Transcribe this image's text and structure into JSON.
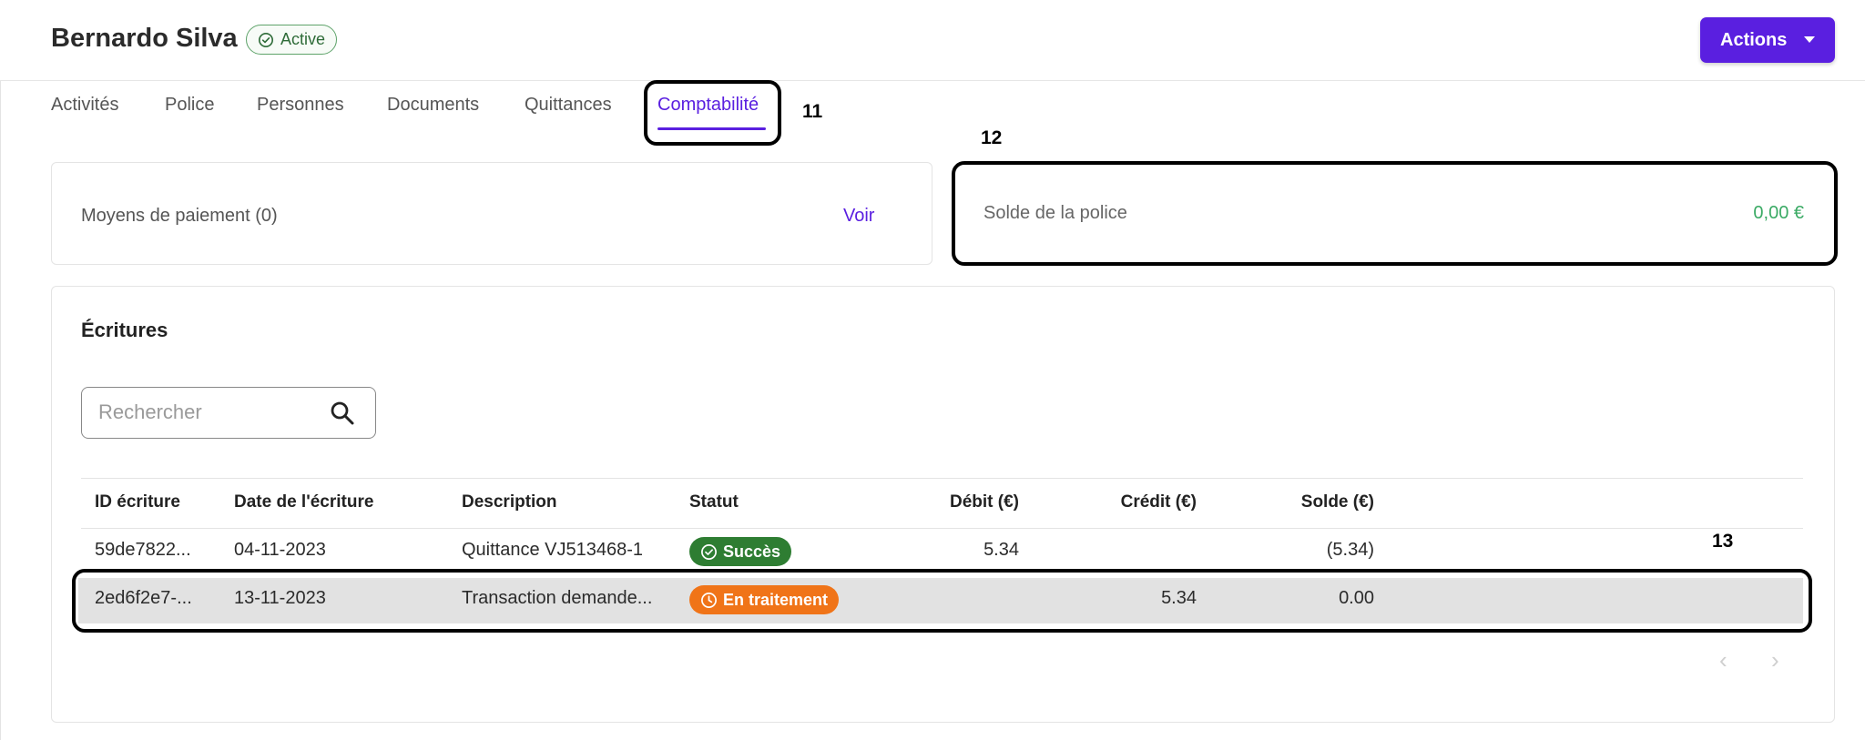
{
  "header": {
    "title": "Bernardo Silva",
    "status": "Active",
    "actions_label": "Actions"
  },
  "tabs": [
    {
      "label": "Activités"
    },
    {
      "label": "Police"
    },
    {
      "label": "Personnes"
    },
    {
      "label": "Documents"
    },
    {
      "label": "Quittances"
    },
    {
      "label": "Comptabilité",
      "active": true
    }
  ],
  "annotations": {
    "tab": "11",
    "balance": "12",
    "row": "13"
  },
  "payment": {
    "label": "Moyens de paiement (0)",
    "link": "Voir"
  },
  "balance": {
    "label": "Solde de la police",
    "value": "0,00 €"
  },
  "entries": {
    "title": "Écritures",
    "search_placeholder": "Rechercher",
    "columns": [
      "ID écriture",
      "Date de l'écriture",
      "Description",
      "Statut",
      "Débit (€)",
      "Crédit (€)",
      "Solde (€)"
    ],
    "rows": [
      {
        "id": "59de7822...",
        "date": "04-11-2023",
        "description": "Quittance VJ513468-1",
        "status": "Succès",
        "debit": "5.34",
        "credit": "",
        "solde": "(5.34)"
      },
      {
        "id": "2ed6f2e7-...",
        "date": "13-11-2023",
        "description": "Transaction demande...",
        "status": "En traitement",
        "debit": "",
        "credit": "5.34",
        "solde": "0.00"
      }
    ],
    "pager_prev": "‹",
    "pager_next": "›"
  },
  "colors": {
    "accent": "#5a1fe0",
    "success": "#2e7d32",
    "pending": "#f07418",
    "balance": "#3aaa64"
  }
}
